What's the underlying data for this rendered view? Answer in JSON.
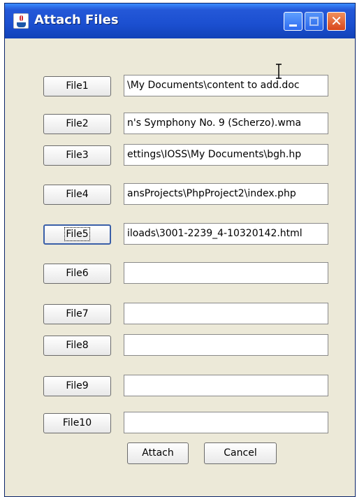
{
  "window": {
    "title": "Attach Files"
  },
  "files": [
    {
      "label": "File1",
      "value": "\\My Documents\\content to add.doc"
    },
    {
      "label": "File2",
      "value": "n's Symphony No. 9 (Scherzo).wma"
    },
    {
      "label": "File3",
      "value": "ettings\\IOSS\\My Documents\\bgh.hp"
    },
    {
      "label": "File4",
      "value": "ansProjects\\PhpProject2\\index.php"
    },
    {
      "label": "File5",
      "value": "iloads\\3001-2239_4-10320142.html"
    },
    {
      "label": "File6",
      "value": ""
    },
    {
      "label": "File7",
      "value": ""
    },
    {
      "label": "File8",
      "value": ""
    },
    {
      "label": "File9",
      "value": ""
    },
    {
      "label": "File10",
      "value": ""
    }
  ],
  "actions": {
    "attach": "Attach",
    "cancel": "Cancel"
  }
}
